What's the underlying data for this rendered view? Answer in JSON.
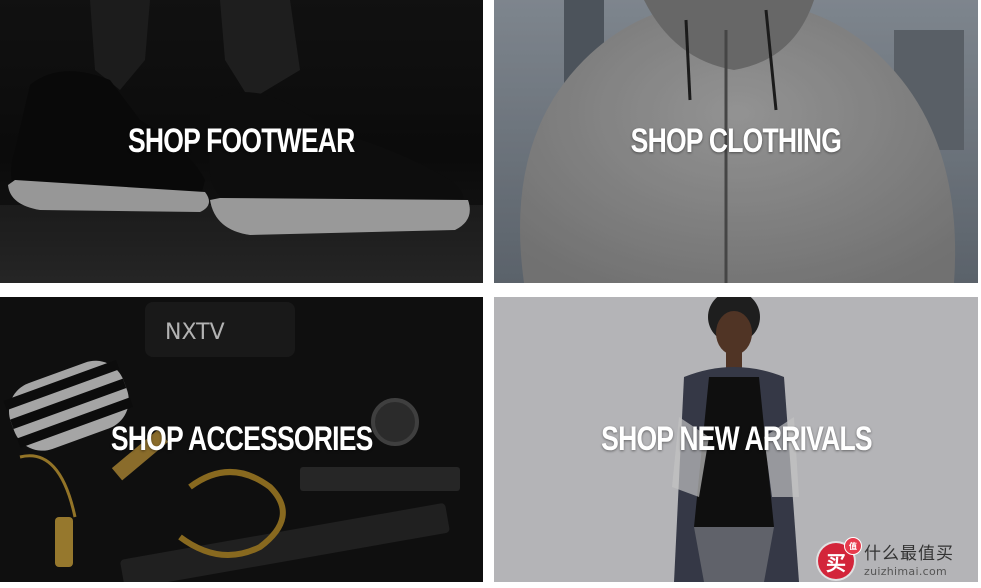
{
  "tiles": {
    "footwear": {
      "label": "SHOP FOOTWEAR",
      "image": "sneakers-photo"
    },
    "clothing": {
      "label": "SHOP CLOTHING",
      "image": "grey-hoodie-photo"
    },
    "accessories": {
      "label": "SHOP ACCESSORIES",
      "image": "accessories-flatlay-photo"
    },
    "arrivals": {
      "label": "SHOP NEW ARRIVALS",
      "image": "model-cardigan-photo"
    }
  },
  "watermark": {
    "logo_glyph": "买",
    "badge": "值",
    "name": "什么最值买",
    "url": "zuizhimai.com"
  }
}
